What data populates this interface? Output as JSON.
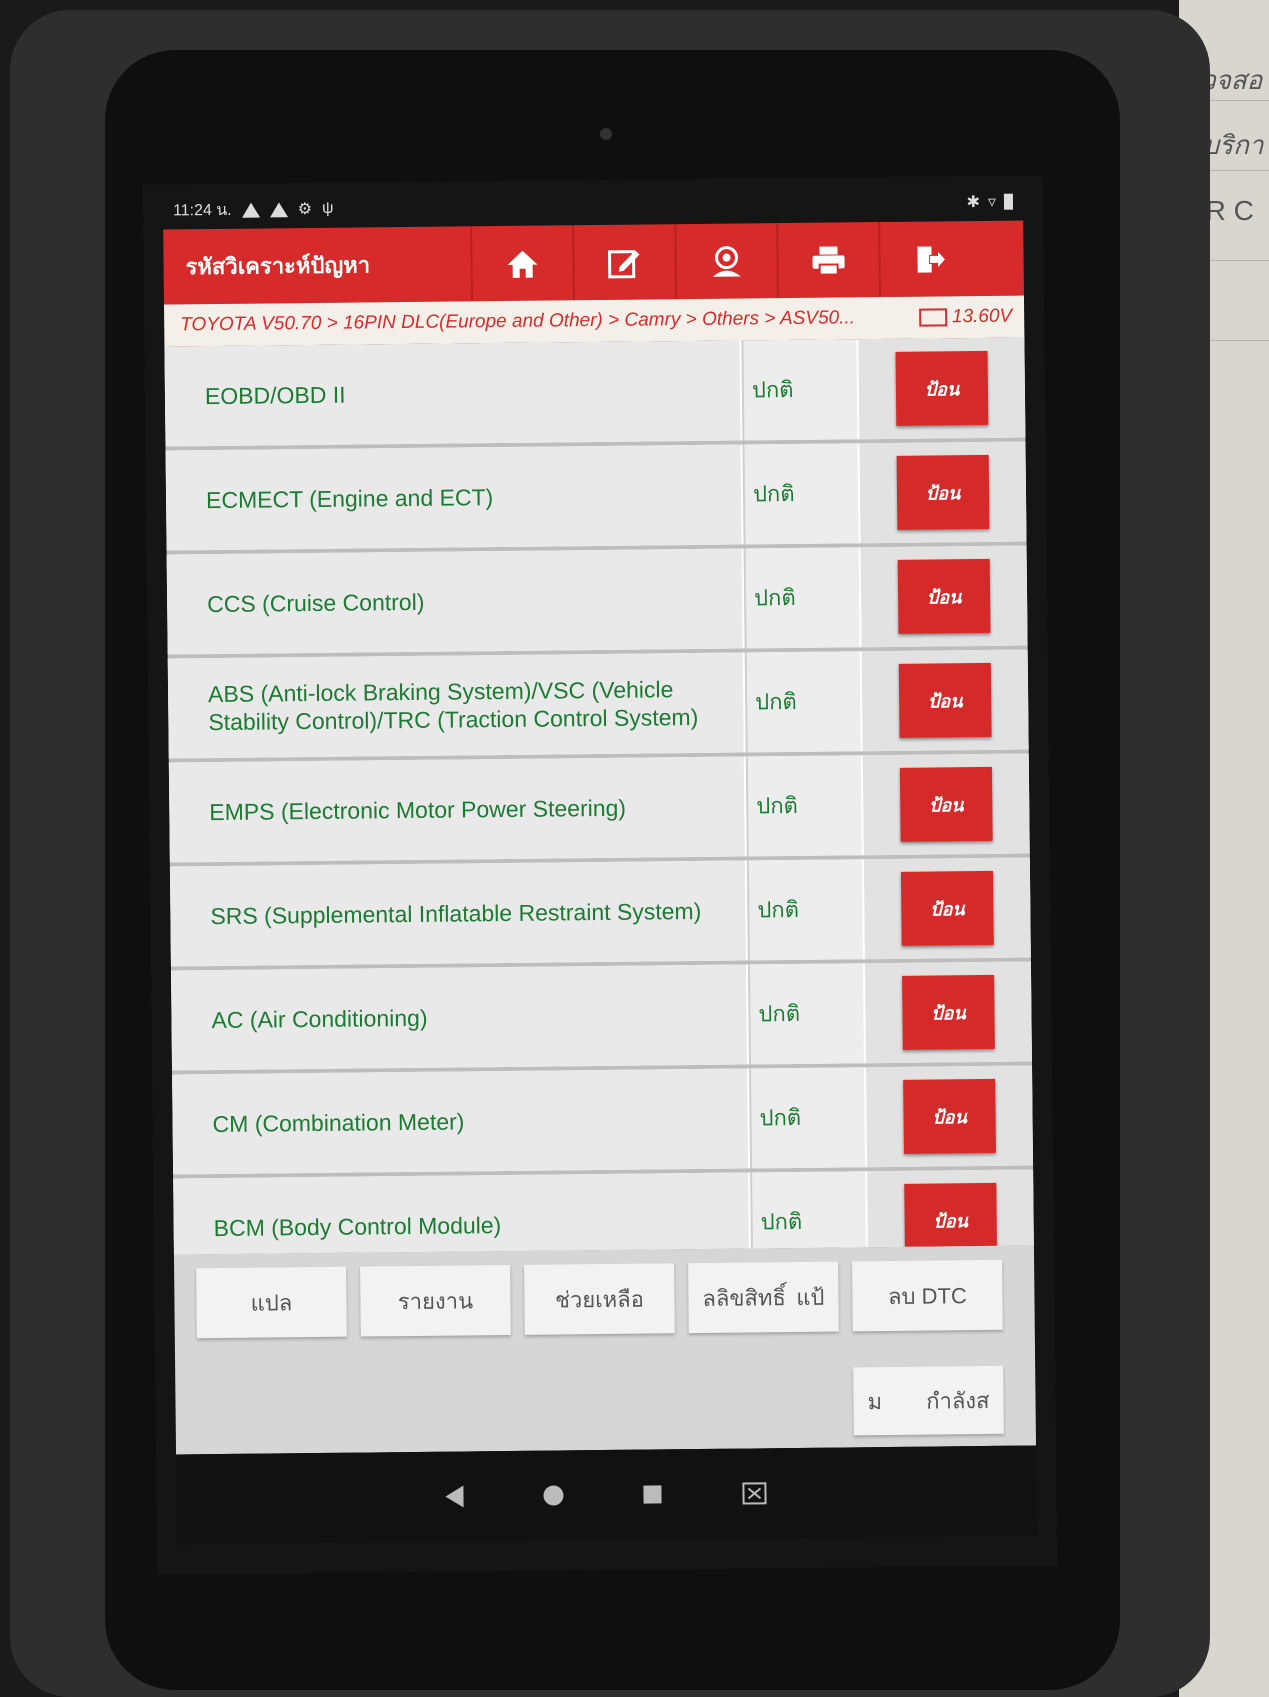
{
  "status_bar": {
    "time": "11:24 น."
  },
  "header": {
    "title": "รหัสวิเคราะห์ปัญหา",
    "icons": [
      "home-icon",
      "edit-icon",
      "user-icon",
      "print-icon",
      "exit-icon"
    ]
  },
  "breadcrumb": {
    "path": "TOYOTA V50.70 > 16PIN DLC(Europe and Other) > Camry > Others > ASV50...",
    "voltage": "13.60V"
  },
  "systems": [
    {
      "name": "EOBD/OBD II",
      "status": "ปกติ",
      "action": "ป้อน"
    },
    {
      "name": "ECMECT (Engine and ECT)",
      "status": "ปกติ",
      "action": "ป้อน"
    },
    {
      "name": "CCS (Cruise Control)",
      "status": "ปกติ",
      "action": "ป้อน"
    },
    {
      "name": "ABS (Anti-lock Braking System)/VSC (Vehicle Stability Control)/TRC (Traction Control System)",
      "status": "ปกติ",
      "action": "ป้อน"
    },
    {
      "name": "EMPS (Electronic Motor Power Steering)",
      "status": "ปกติ",
      "action": "ป้อน"
    },
    {
      "name": "SRS (Supplemental Inflatable Restraint System)",
      "status": "ปกติ",
      "action": "ป้อน"
    },
    {
      "name": "AC (Air Conditioning)",
      "status": "ปกติ",
      "action": "ป้อน"
    },
    {
      "name": "CM (Combination Meter)",
      "status": "ปกติ",
      "action": "ป้อน"
    },
    {
      "name": "BCM (Body Control Module)",
      "status": "ปกติ",
      "action": "ป้อน"
    }
  ],
  "footer": {
    "translate": "แปล",
    "report": "รายงาน",
    "help": "ช่วยเหลือ",
    "copyright_left": "ลลิขสิทธิ์",
    "copyright_right": "แป้",
    "clear_dtc": "ลบ DTC",
    "more_left": "ม",
    "more_right": "กำลังส"
  },
  "paper": {
    "line1": "รวจสอ",
    "line2": "อบริกา",
    "line3": "AR C"
  },
  "colors": {
    "accent": "#d72b2b",
    "status_green": "#1c7a33"
  }
}
